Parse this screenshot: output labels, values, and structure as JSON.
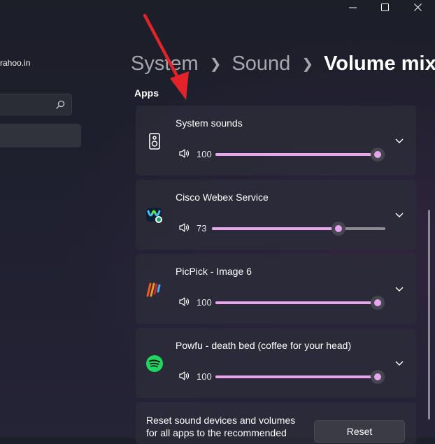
{
  "sidebar": {
    "account_email": "rahoo.in",
    "search_placeholder": ""
  },
  "window_controls": [
    "minimize",
    "maximize",
    "close"
  ],
  "breadcrumb": {
    "items": [
      "System",
      "Sound",
      "Volume mixer"
    ]
  },
  "section_title": "Apps",
  "apps": [
    {
      "name": "System sounds",
      "volume": "100",
      "level": 1.0,
      "icon": "speaker-icon"
    },
    {
      "name": "Cisco Webex Service",
      "volume": "73",
      "level": 0.73,
      "icon": "webex-icon"
    },
    {
      "name": "PicPick - Image 6",
      "volume": "100",
      "level": 1.0,
      "icon": "picpick-icon"
    },
    {
      "name": "Powfu - death bed (coffee for your head)",
      "volume": "100",
      "level": 1.0,
      "icon": "spotify-icon"
    }
  ],
  "reset": {
    "description": "Reset sound devices and volumes for all apps to the recommended",
    "button_label": "Reset"
  },
  "colors": {
    "accent": "#e8a4ec",
    "arrow": "#e0242a"
  }
}
